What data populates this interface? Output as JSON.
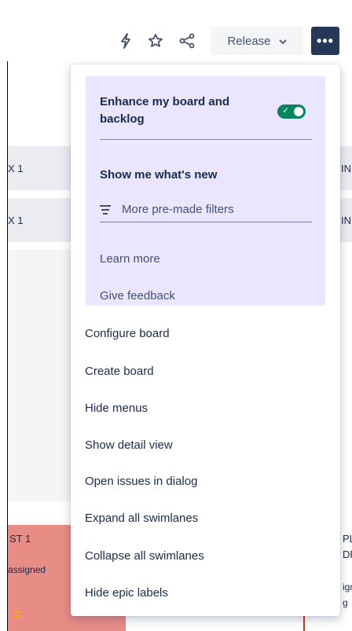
{
  "toolbar": {
    "release_label": "Release",
    "more_label": "•••"
  },
  "board": {
    "row1_left": "X 1",
    "row1_right": "IN",
    "row2_left": "X 1",
    "row2_right": "IN",
    "card_left_title": "ST 1",
    "card_left_sub": "assigned",
    "card_left_mark": "=",
    "card_right_line1": "PL",
    "card_right_line2": "DR",
    "card_right_line3": "ign",
    "card_right_line4": "g"
  },
  "menu": {
    "promo": {
      "title": "Enhance my board and backlog",
      "toggle_on": true,
      "toggle_check": "✓",
      "whats_new": "Show me what's new",
      "filters": "More pre-made filters",
      "learn_more": "Learn more",
      "feedback": "Give feedback"
    },
    "items": [
      "Configure board",
      "Create board",
      "Hide menus",
      "Show detail view",
      "Open issues in dialog",
      "Expand all swimlanes",
      "Collapse all swimlanes",
      "Hide epic labels"
    ]
  },
  "colors": {
    "promo_bg": "#eae6ff",
    "toggle": "#00875a",
    "more_button": "#253858"
  }
}
